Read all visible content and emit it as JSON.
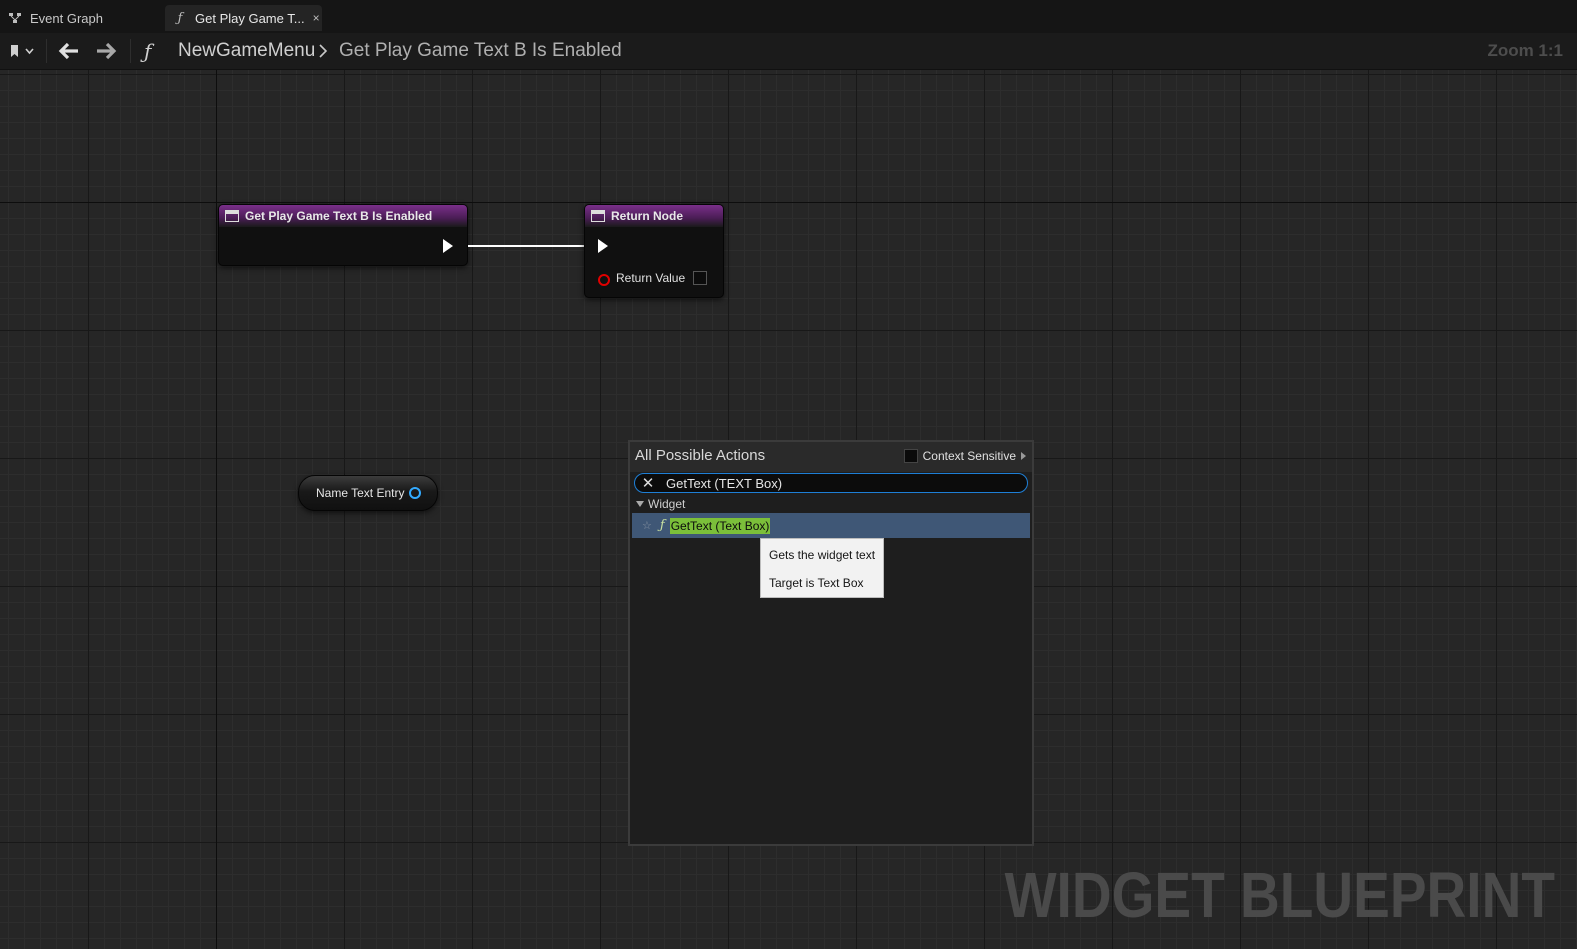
{
  "tabs": [
    {
      "label": "Event Graph",
      "icon": "event-graph-icon"
    },
    {
      "label": "Get Play Game T...",
      "icon": "function-icon",
      "close": "×"
    }
  ],
  "toolbar": {
    "breadcrumb_root": "NewGameMenu",
    "breadcrumb_current": "Get Play Game Text B Is Enabled",
    "zoom": "Zoom 1:1"
  },
  "nodes": {
    "entry_title": "Get Play Game Text B Is Enabled",
    "return_title": "Return Node",
    "return_value_label": "Return Value",
    "variable_label": "Name Text Entry"
  },
  "action_menu": {
    "title": "All Possible Actions",
    "context_sensitive_label": "Context Sensitive",
    "search_value": "GetText (TEXT Box)",
    "category": "Widget",
    "item_label": "GetText (Text Box)"
  },
  "tooltip": {
    "line1": "Gets the widget text",
    "line2": "Target is Text Box"
  },
  "watermark": "WIDGET BLUEPRINT",
  "colors": {
    "node_header": "#7a2f8a",
    "selection": "#3f5776",
    "search_highlight": "#7bbf3a",
    "object_pin": "#33aaff",
    "bool_pin": "#e00000"
  }
}
